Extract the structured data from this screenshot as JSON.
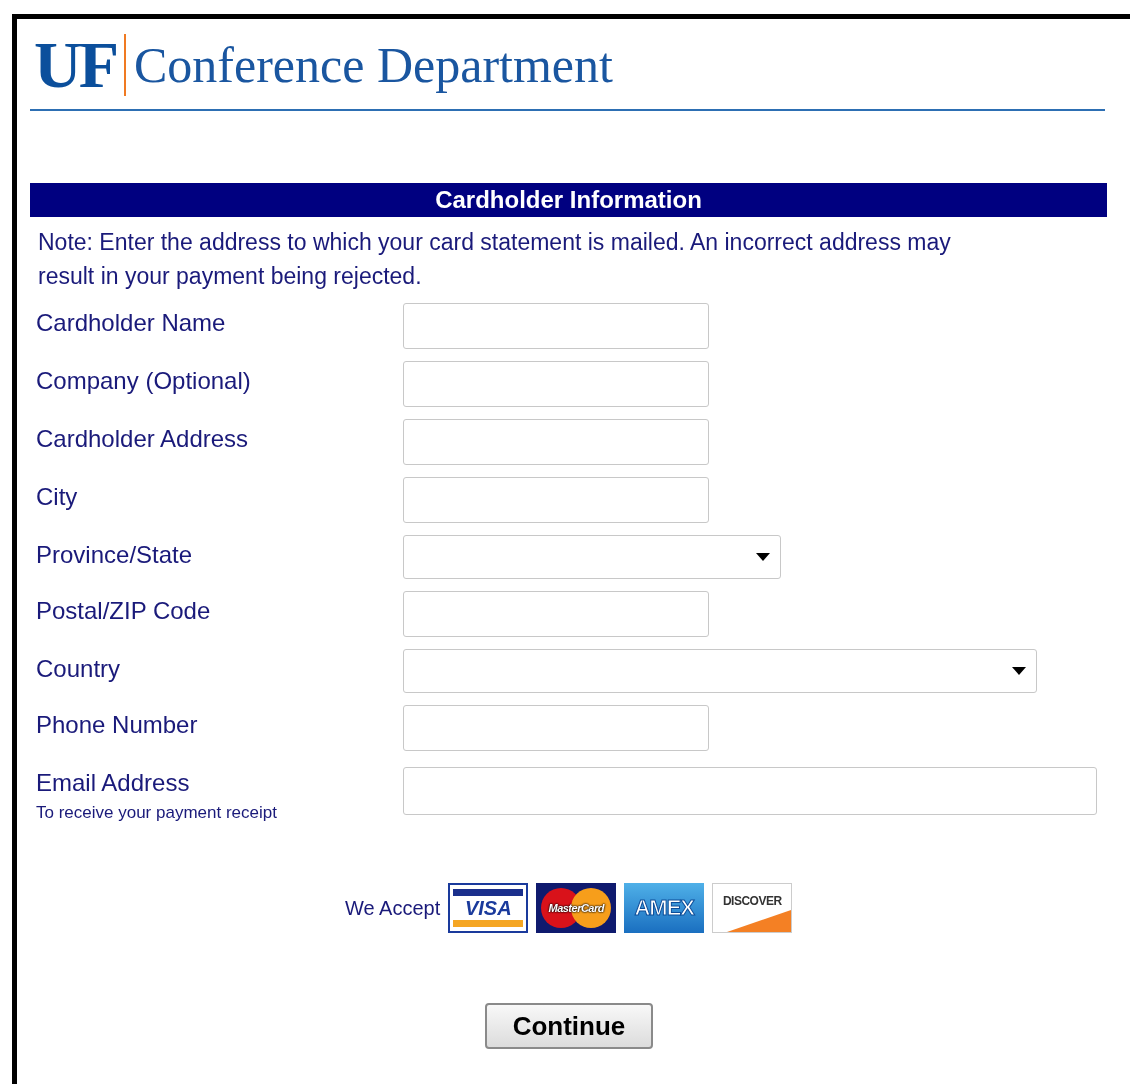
{
  "header": {
    "logo_mark": "UF",
    "title": "Conference Department"
  },
  "section": {
    "title": "Cardholder Information",
    "note": "Note: Enter the address to which your card statement is mailed. An incorrect address may result in your payment being rejected."
  },
  "fields": [
    {
      "label": "Cardholder Name",
      "kind": "text"
    },
    {
      "label": "Company (Optional)",
      "kind": "text"
    },
    {
      "label": "Cardholder Address",
      "kind": "text"
    },
    {
      "label": "City",
      "kind": "text"
    },
    {
      "label": "Province/State",
      "kind": "select"
    },
    {
      "label": "Postal/ZIP Code",
      "kind": "text"
    },
    {
      "label": "Country",
      "kind": "select",
      "wide": true
    },
    {
      "label": "Phone Number",
      "kind": "text"
    },
    {
      "label": "Email Address",
      "kind": "text",
      "wide": true,
      "hint": "To receive your payment receipt"
    }
  ],
  "accepted": {
    "label": "We Accept",
    "cards": [
      {
        "kind": "visa",
        "text": "VISA"
      },
      {
        "kind": "mastercard",
        "text": "MasterCard"
      },
      {
        "kind": "amex",
        "text": "AMEX"
      },
      {
        "kind": "discover",
        "text": "DISCOVER"
      }
    ]
  },
  "button": "Continue"
}
